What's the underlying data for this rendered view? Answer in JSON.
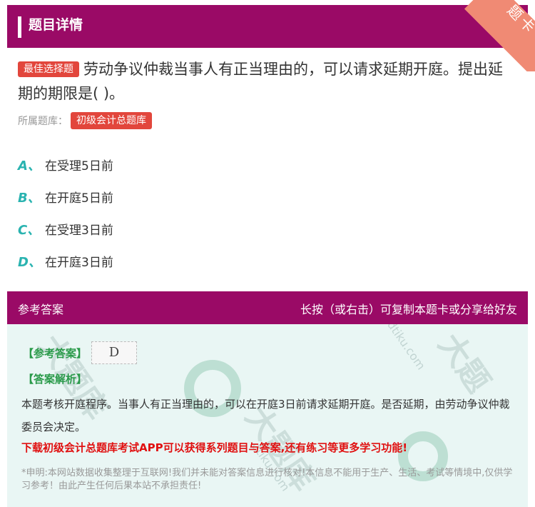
{
  "header": {
    "title": "题目详情",
    "corner_label": "题卡"
  },
  "question": {
    "badge": "最佳选择题",
    "text": "劳动争议仲裁当事人有正当理由的，可以请求延期开庭。提出延期的期限是( )。"
  },
  "source": {
    "label": "所属题库：",
    "bank": "初级会计总题库"
  },
  "options": [
    {
      "letter": "A、",
      "text": "在受理5日前"
    },
    {
      "letter": "B、",
      "text": "在开庭5日前"
    },
    {
      "letter": "C、",
      "text": "在受理3日前"
    },
    {
      "letter": "D、",
      "text": "在开庭3日前"
    }
  ],
  "answer_section": {
    "left_label": "参考答案",
    "right_label": "长按（或右击）可复制本题卡或分享给好友",
    "answer_label": "【参考答案】",
    "answer_value": "D",
    "analysis_label": "【答案解析】",
    "analysis_text": "本题考核开庭程序。当事人有正当理由的，可以在开庭3日前请求延期开庭。是否延期，由劳动争议仲裁委员会决定。",
    "promo": "下载初级会计总题库考试APP可以获得系列题目与答案,还有练习等更多学习功能!",
    "disclaimer": "*申明:本网站数据收集整理于互联网!我们并未能对答案信息进行核对!本信息不能用于生产、生活、考试等情境中,仅供学习参考！由此产生任何后果本站不承担责任!"
  },
  "colors": {
    "header_bg": "#9a0a66",
    "badge_red": "#e2463c",
    "option_letter": "#2ab3b0",
    "answer_green": "#2a9a4a",
    "promo_red": "#e01010",
    "answer_bg": "#e9f6f4"
  }
}
